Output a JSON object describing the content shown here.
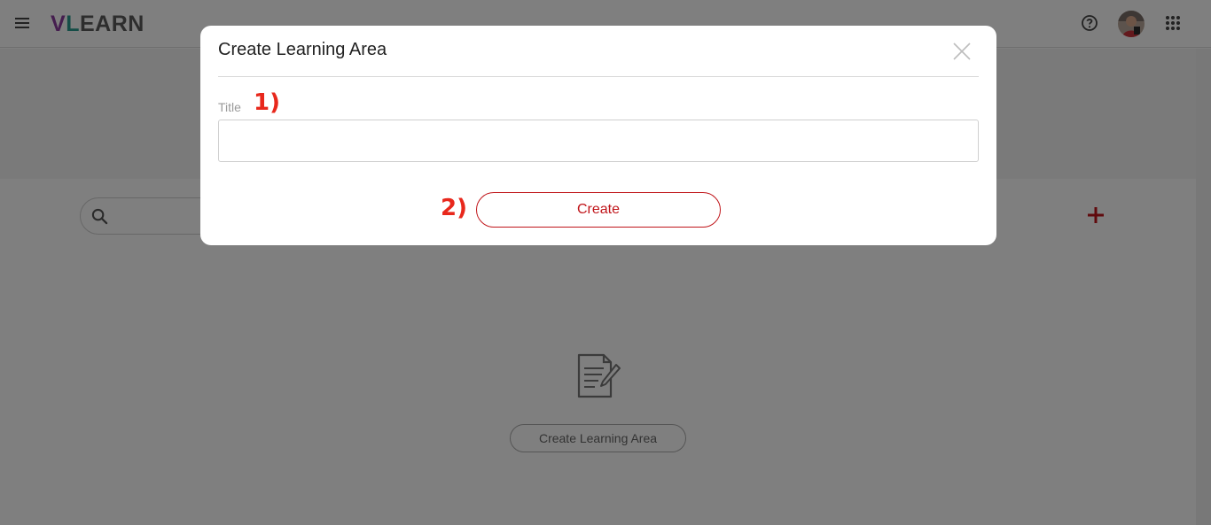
{
  "app": {
    "logo_text_v": "V",
    "logo_text_l": "L",
    "logo_text_rest": "EARN"
  },
  "header": {
    "menu_icon": "hamburger-icon",
    "help_icon": "help-circle-icon",
    "apps_icon": "grid-apps-icon"
  },
  "toolbar": {
    "search_placeholder": "",
    "add_icon": "plus-icon"
  },
  "empty_state": {
    "icon": "document-edit-icon",
    "button_label": "Create Learning Area"
  },
  "modal": {
    "title": "Create Learning Area",
    "field_label": "Title",
    "field_value": "",
    "submit_label": "Create"
  },
  "annotations": {
    "step1": "1)",
    "step2": "2)"
  },
  "colors": {
    "accent": "#c0151a",
    "annotation": "#e8281c",
    "overlay": "rgba(0,0,0,0.5)"
  }
}
